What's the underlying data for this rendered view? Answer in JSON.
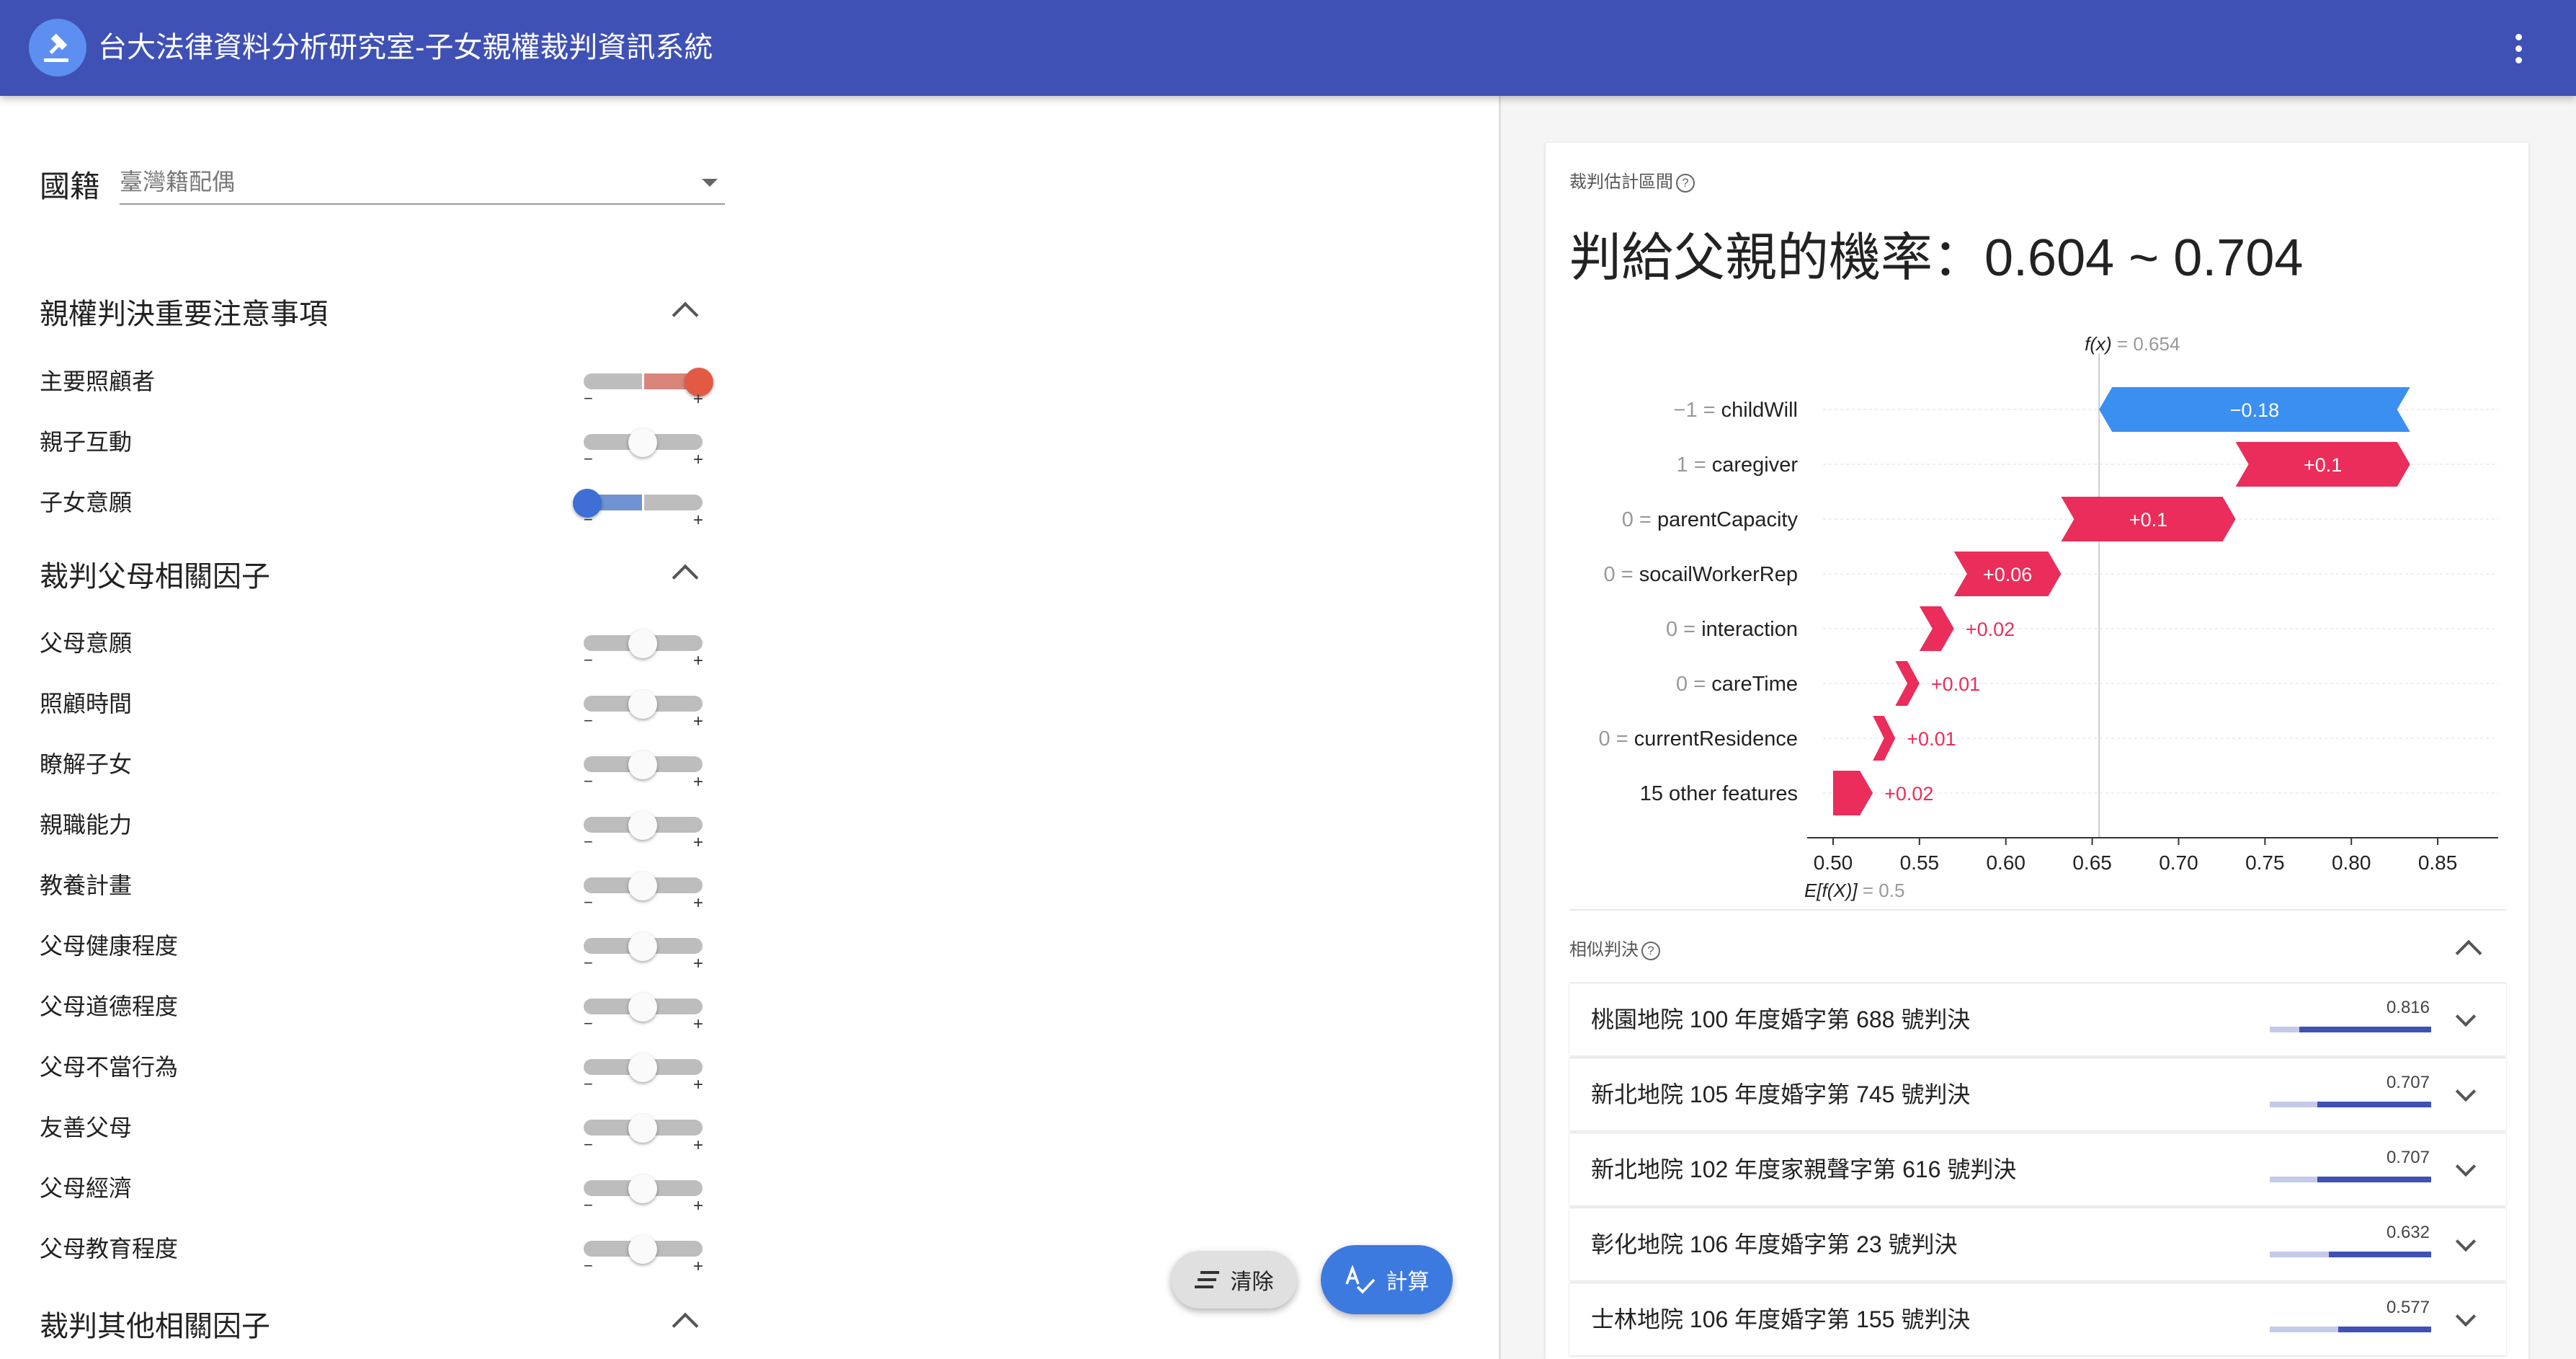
{
  "app": {
    "title": "台大法律資料分析研究室-子女親權裁判資訊系統"
  },
  "nationality": {
    "label": "國籍",
    "value": "臺灣籍配偶"
  },
  "sections": {
    "important": {
      "title": "親權判決重要注意事項"
    },
    "parent_factors": {
      "title": "裁判父母相關因子"
    },
    "other_factors": {
      "title": "裁判其他相關因子"
    }
  },
  "sliders": {
    "important": [
      {
        "label": "主要照顧者",
        "level": 1
      },
      {
        "label": "親子互動",
        "level": 0
      },
      {
        "label": "子女意願",
        "level": -1
      }
    ],
    "parent": [
      {
        "label": "父母意願",
        "level": 0
      },
      {
        "label": "照顧時間",
        "level": 0
      },
      {
        "label": "瞭解子女",
        "level": 0
      },
      {
        "label": "親職能力",
        "level": 0
      },
      {
        "label": "教養計畫",
        "level": 0
      },
      {
        "label": "父母健康程度",
        "level": 0
      },
      {
        "label": "父母道德程度",
        "level": 0
      },
      {
        "label": "父母不當行為",
        "level": 0
      },
      {
        "label": "友善父母",
        "level": 0
      },
      {
        "label": "父母經濟",
        "level": 0
      },
      {
        "label": "父母教育程度",
        "level": 0
      }
    ],
    "minus": "−",
    "plus": "+"
  },
  "buttons": {
    "clear": "清除",
    "calc": "計算"
  },
  "estimate": {
    "label": "裁判估計區間",
    "headline": "判給父親的機率：0.604 ~ 0.704"
  },
  "chart_data": {
    "type": "waterfall",
    "fx_label": "f(x)",
    "fx_value": "= 0.654",
    "base_label": "E[f(X)]",
    "base_value": "= 0.5",
    "base": 0.5,
    "fx": 0.654,
    "xlim": [
      0.49,
      0.885
    ],
    "ticks": [
      0.5,
      0.55,
      0.6,
      0.65,
      0.7,
      0.75,
      0.8,
      0.85
    ],
    "tick_labels": [
      "0.50",
      "0.55",
      "0.60",
      "0.65",
      "0.70",
      "0.75",
      "0.80",
      "0.85"
    ],
    "colors": {
      "negative": "#3b8ff0",
      "positive": "#ea2d5a"
    },
    "features": [
      {
        "value": "−1",
        "name": "childWill",
        "contribution": -0.18,
        "label": "−0.18",
        "start": 0.834,
        "end": 0.654
      },
      {
        "value": "1",
        "name": "caregiver",
        "contribution": 0.1,
        "label": "+0.1",
        "start": 0.733,
        "end": 0.834
      },
      {
        "value": "0",
        "name": "parentCapacity",
        "contribution": 0.1,
        "label": "+0.1",
        "start": 0.632,
        "end": 0.733
      },
      {
        "value": "0",
        "name": "socailWorkerRep",
        "contribution": 0.06,
        "label": "+0.06",
        "start": 0.57,
        "end": 0.632
      },
      {
        "value": "0",
        "name": "interaction",
        "contribution": 0.02,
        "label": "+0.02",
        "start": 0.55,
        "end": 0.57
      },
      {
        "value": "0",
        "name": "careTime",
        "contribution": 0.01,
        "label": "+0.01",
        "start": 0.536,
        "end": 0.55
      },
      {
        "value": "0",
        "name": "currentResidence",
        "contribution": 0.01,
        "label": "+0.01",
        "start": 0.523,
        "end": 0.536
      },
      {
        "value": "",
        "name": "15 other features",
        "contribution": 0.02,
        "label": "+0.02",
        "start": 0.5,
        "end": 0.523
      }
    ]
  },
  "similar": {
    "label": "相似判決",
    "cases": [
      {
        "title": "桃園地院 100 年度婚字第 688 號判決",
        "score": "0.816",
        "fraction": 0.816
      },
      {
        "title": "新北地院 105 年度婚字第 745 號判決",
        "score": "0.707",
        "fraction": 0.707
      },
      {
        "title": "新北地院 102 年度家親聲字第 616 號判決",
        "score": "0.707",
        "fraction": 0.707
      },
      {
        "title": "彰化地院 106 年度婚字第 23 號判決",
        "score": "0.632",
        "fraction": 0.632
      },
      {
        "title": "士林地院 106 年度婚字第 155 號判決",
        "score": "0.577",
        "fraction": 0.577
      }
    ]
  }
}
